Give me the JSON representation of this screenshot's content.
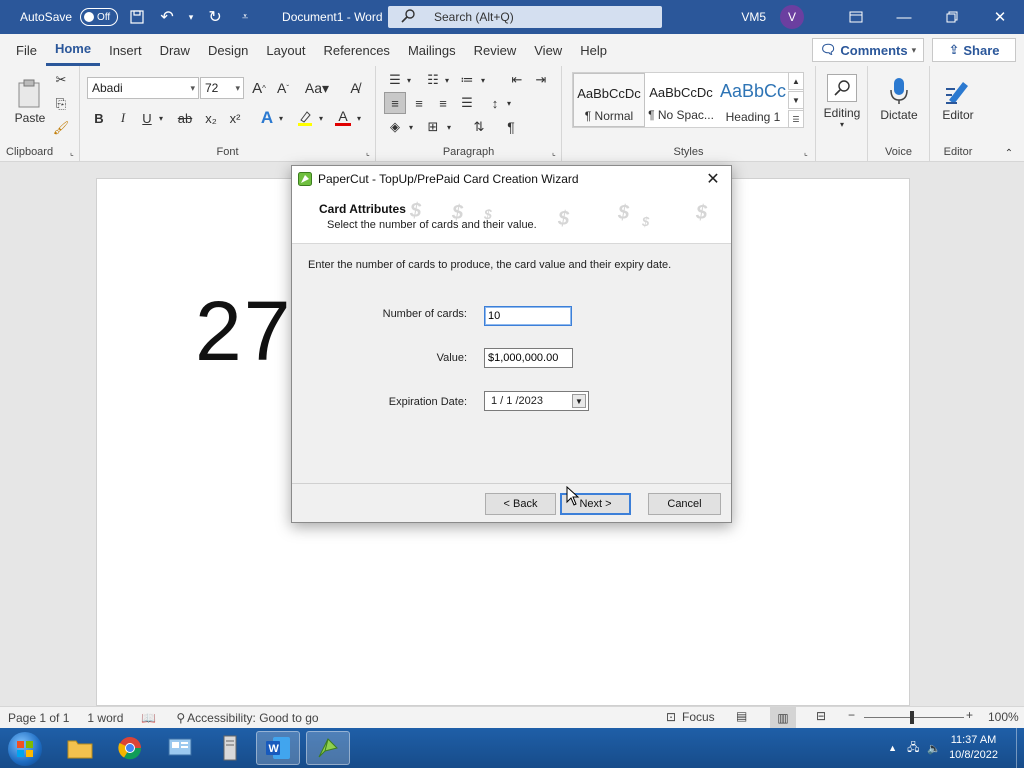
{
  "titlebar": {
    "autosave_label": "AutoSave",
    "autosave_state": "Off",
    "doc_title": "Document1 - Word",
    "search_placeholder": "Search (Alt+Q)",
    "user_initials": "VM5",
    "avatar_letter": "V"
  },
  "tabs": [
    "File",
    "Home",
    "Insert",
    "Draw",
    "Design",
    "Layout",
    "References",
    "Mailings",
    "Review",
    "View",
    "Help"
  ],
  "active_tab": "Home",
  "actions": {
    "comments": "Comments",
    "share": "Share"
  },
  "ribbon": {
    "clipboard": {
      "paste": "Paste",
      "label": "Clipboard"
    },
    "font": {
      "name": "Abadi",
      "size": "72",
      "label": "Font",
      "bold": "B",
      "italic": "I",
      "underline": "U",
      "strike": "ab",
      "subscript": "x₂",
      "superscript": "x²",
      "grow": "A^",
      "shrink": "A˅",
      "case": "Aa",
      "clear": "A"
    },
    "paragraph": {
      "label": "Paragraph",
      "pilcrow": "¶"
    },
    "styles": {
      "label": "Styles",
      "items": [
        {
          "preview": "AaBbCcDc",
          "name": "¶ Normal"
        },
        {
          "preview": "AaBbCcDc",
          "name": "¶ No Spac..."
        },
        {
          "preview": "AaBbCc",
          "name": "Heading 1"
        }
      ]
    },
    "editing": {
      "label": "Editing"
    },
    "voice": {
      "dictate": "Dictate",
      "label": "Voice"
    },
    "editor": {
      "button": "Editor",
      "label": "Editor"
    }
  },
  "document": {
    "text": "27"
  },
  "statusbar": {
    "page": "Page 1 of 1",
    "words": "1 word",
    "accessibility": "Accessibility: Good to go",
    "focus": "Focus",
    "zoom": "100%",
    "zoom_level": 1.0
  },
  "taskbar": {
    "time": "11:37 AM",
    "date": "10/8/2022"
  },
  "dialog": {
    "title": "PaperCut - TopUp/PrePaid Card Creation Wizard",
    "header_title": "Card Attributes",
    "header_subtitle": "Select the number of cards and their value.",
    "instruction": "Enter the number of cards to produce, the card value and their expiry date.",
    "fields": {
      "num_cards_label": "Number of cards:",
      "num_cards_value": "10",
      "value_label": "Value:",
      "value_value": "$1,000,000.00",
      "expiry_label": "Expiration Date:",
      "expiry_value": "1 / 1 /2023"
    },
    "buttons": {
      "back": "< Back",
      "next": "Next >",
      "cancel": "Cancel"
    },
    "header_glyph": "$"
  },
  "colors": {
    "accent": "#2b579a",
    "avatar": "#6b3fa0",
    "focus": "#3c7fd8"
  }
}
